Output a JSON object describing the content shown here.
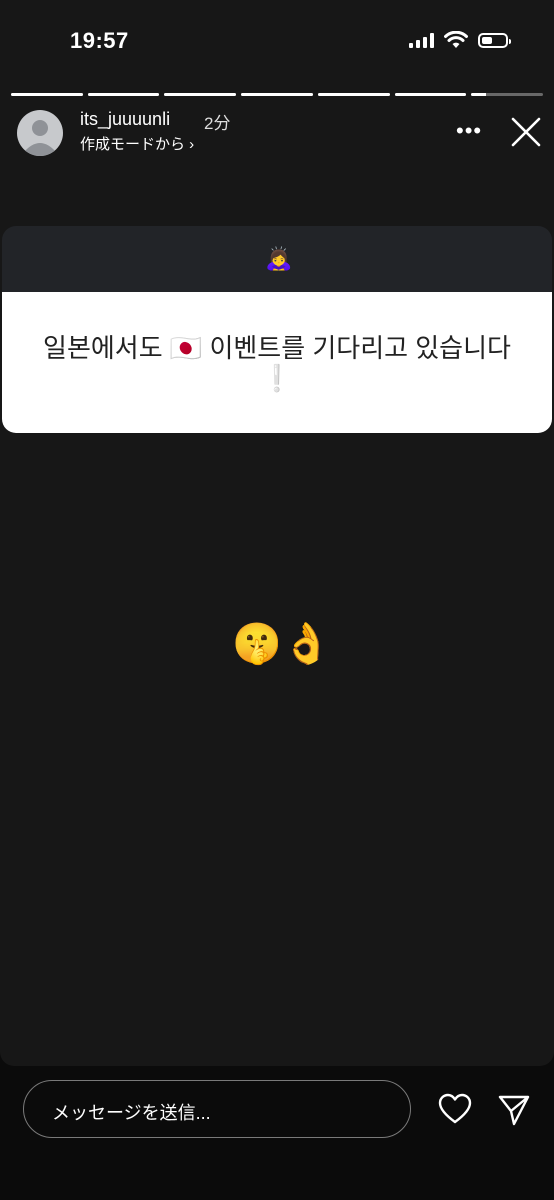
{
  "status_bar": {
    "time": "19:57",
    "battery_level": 0.45
  },
  "progress": {
    "segment_count": 7,
    "completed_segments": 6,
    "current_segment_progress": 0.2
  },
  "header": {
    "username": "its_juuuunli",
    "time_ago": "2分",
    "subtitle": "作成モードから ›",
    "more_label": "•••",
    "icons": {
      "more": "more-horizontal-icon",
      "close": "close-icon"
    }
  },
  "sticker": {
    "emoji": "🙇‍♀️",
    "text": "일본에서도 🇯🇵 이벤트를 기다리고 있습니다",
    "mark": "❕"
  },
  "content": {
    "emoji": "🤫👌"
  },
  "bottom": {
    "message_placeholder": "メッセージを送信...",
    "icons": {
      "like": "heart-icon",
      "share": "send-icon"
    }
  },
  "colors": {
    "background": "#171717",
    "sticker_header": "#222428",
    "sticker_body": "#ffffff"
  }
}
